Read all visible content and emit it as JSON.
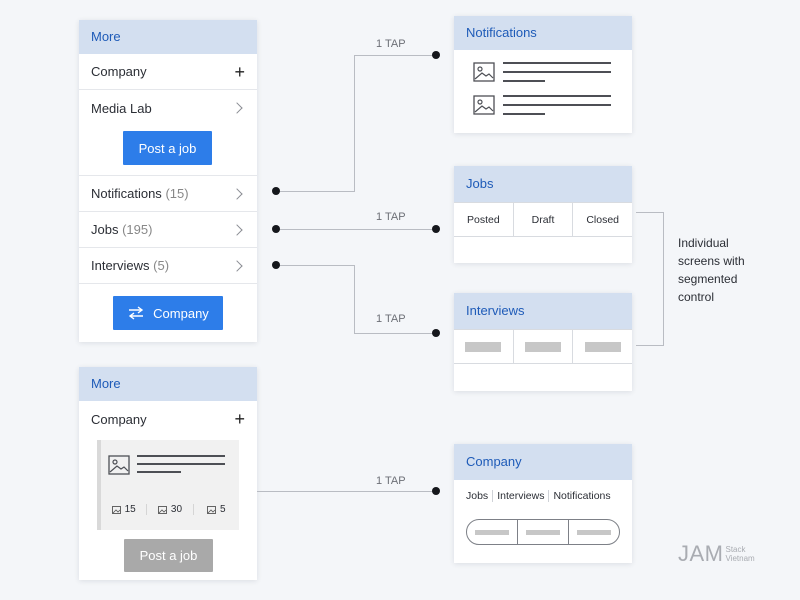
{
  "left_top_card": {
    "header": "More",
    "company_label": "Company",
    "company_action": "+",
    "media_lab_label": "Media Lab",
    "post_job_button": "Post a job",
    "notifications_label": "Notifications",
    "notifications_count": "(15)",
    "jobs_label": "Jobs",
    "jobs_count": "(195)",
    "interviews_label": "Interviews",
    "interviews_count": "(5)",
    "switch_company_button": "Company"
  },
  "left_bottom_card": {
    "header": "More",
    "company_label": "Company",
    "company_action": "+",
    "stats": [
      "15",
      "30",
      "5"
    ],
    "post_job_button": "Post a job"
  },
  "connectors": {
    "tap_label": "1 TAP"
  },
  "notifications_card": {
    "header": "Notifications"
  },
  "jobs_card": {
    "header": "Jobs",
    "segments": [
      "Posted",
      "Draft",
      "Closed"
    ]
  },
  "interviews_card": {
    "header": "Interviews"
  },
  "company_card": {
    "header": "Company",
    "tabs": [
      "Jobs",
      "Interviews",
      "Notifications"
    ]
  },
  "annotation": {
    "lines": [
      "Individual",
      "screens with",
      "segmented",
      "control"
    ]
  },
  "watermark": {
    "brand": "JAM",
    "sub1": "Stack",
    "sub2": "Vietnam"
  },
  "colors": {
    "accent": "#2d7de9",
    "header_bg": "#d3dff0",
    "header_text": "#1e5bb8"
  }
}
